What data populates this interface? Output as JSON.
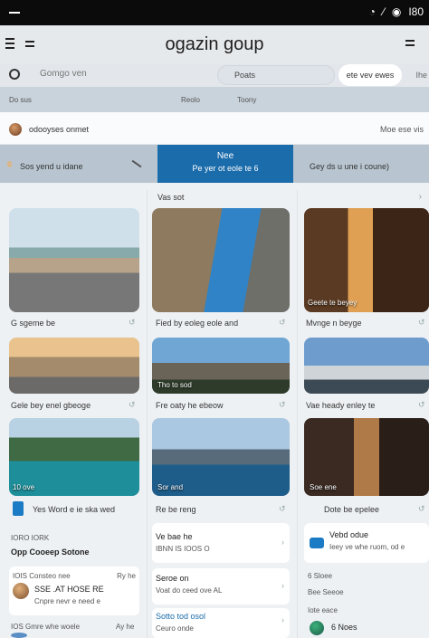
{
  "status": {
    "right_label": "I80"
  },
  "app": {
    "title": "ogazin goup"
  },
  "search": {
    "placeholder": "Gomgo ven",
    "pill_center": "Poats",
    "pill_right": "ete vev ewes",
    "pill_edge": "Ihe"
  },
  "filters": [
    "Do sus",
    "Reolo",
    "Toony"
  ],
  "user": {
    "name": "odooyses onmet",
    "link": "Moe ese vis"
  },
  "banner": {
    "left": "Sos yend u idane",
    "mid_title": "Nee",
    "mid_sub": "Pe yer ot eole te 6",
    "right": "Gey ds u une i coune)"
  },
  "section": {
    "label": "Vas sot"
  },
  "grid": {
    "row1": [
      "G sgeme be",
      "Fied by eoleg eole and",
      "Mvnge n beyge"
    ],
    "row2": [
      "Gele bey enel gbeoge",
      "Fre oaty he ebeow",
      "Vae heady enley te"
    ],
    "row3": [
      "Yes Word e ie ska wed",
      "Re be reng",
      "Dote be epelee"
    ],
    "row3_image_labels": [
      "10 ove",
      "Sor and",
      "Soe ene"
    ],
    "row1_image_labels": [
      "Geete te beyey"
    ],
    "row2_image_labels": [
      "Tho to sod"
    ]
  },
  "left_col": {
    "header_small": "IORO   IORK",
    "title": "Opp Cooeep Sotone",
    "item1_small": "IOIS Consteo nee",
    "item1_time": "Ry he",
    "item1_text": "SSE .AT HOSE RE",
    "item1_sub": "Cnpre nevr e need e",
    "item2_small": "IOS Gmre whe woele",
    "item2_time": "Ay he"
  },
  "mid_col": {
    "item1_title": "Ve bae he",
    "item1_sub": "IBNN IS IOOS O",
    "item2_title": "Seroe on",
    "item2_sub": "Voat do ceed ove AL",
    "item3_title": "Sotto tod osol",
    "item3_sub": "Ceuro onde"
  },
  "right_col": {
    "item1_title": "Vebd odue",
    "item1_sub": "Ieey ve whe ruom, od e",
    "item2_small": "6 Sloee",
    "item2_small2": "Bee Seeoe",
    "item3_small": "Iote eace",
    "item3_text": "6 Noes"
  }
}
